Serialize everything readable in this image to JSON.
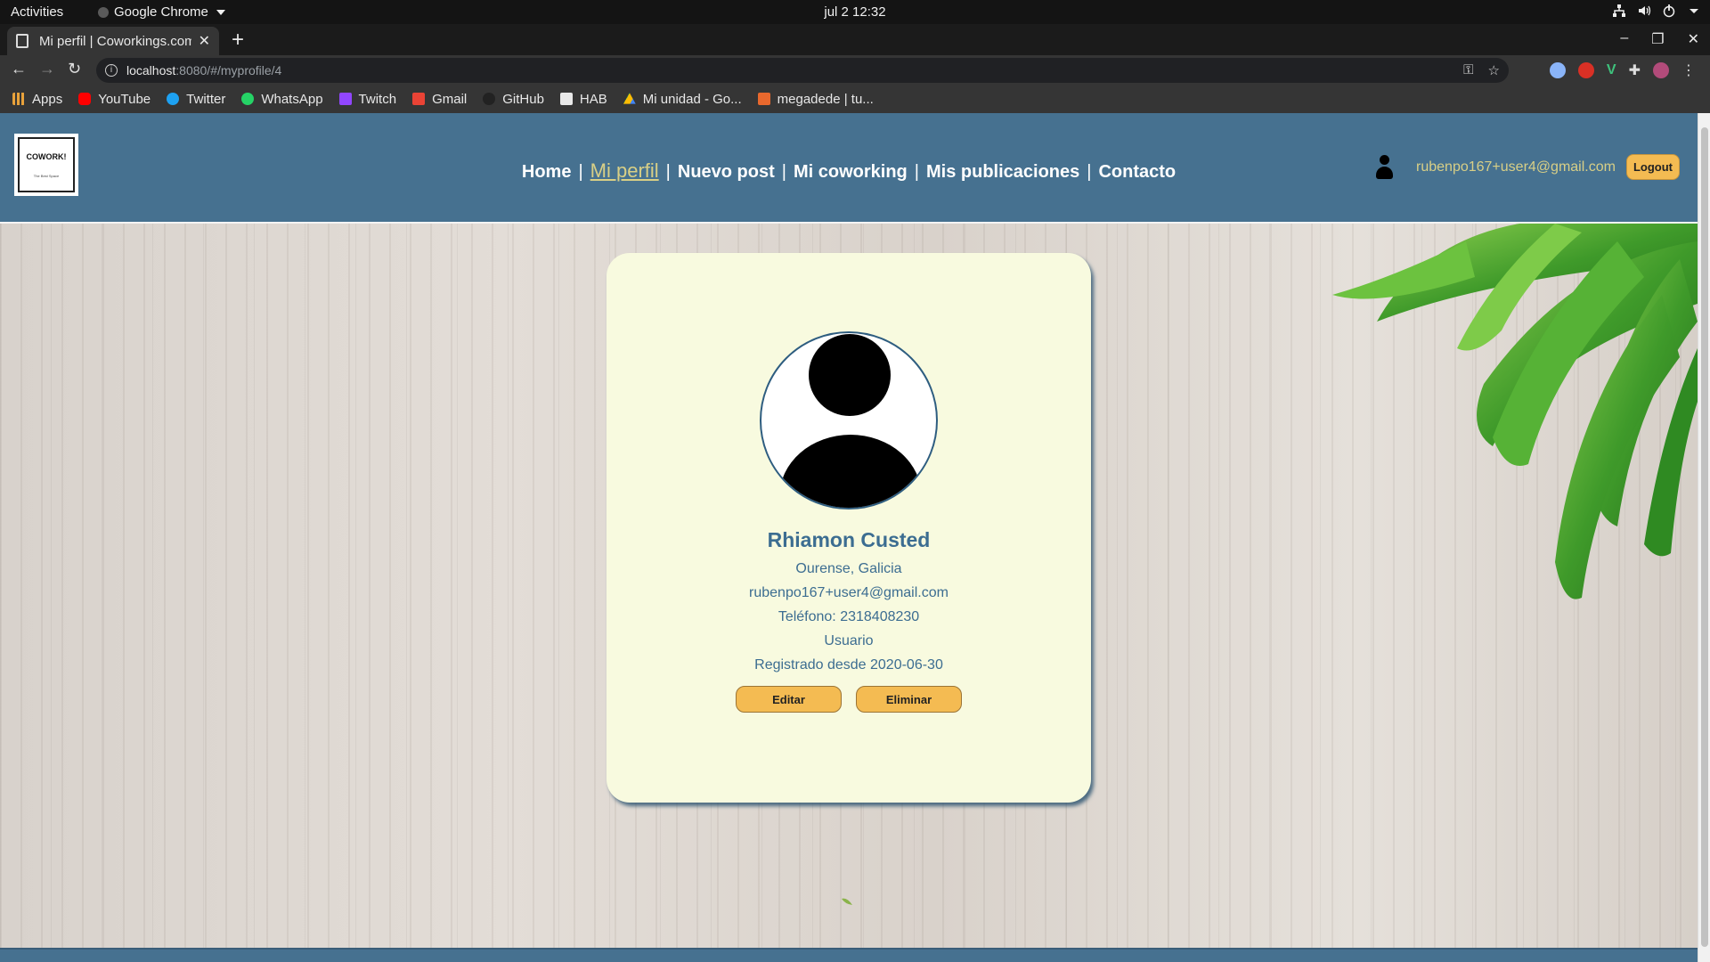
{
  "system": {
    "activities_label": "Activities",
    "app_name": "Google Chrome",
    "clock": "jul 2  12:32"
  },
  "browser": {
    "tab_title": "Mi perfil | Coworkings.com",
    "url_host": "localhost",
    "url_path": ":8080/#/myprofile/4",
    "bookmarks": [
      {
        "label": "Apps",
        "icon": "apps-grid-icon",
        "color": "#e9a23b"
      },
      {
        "label": "YouTube",
        "icon": "youtube-icon",
        "color": "#ff0000"
      },
      {
        "label": "Twitter",
        "icon": "twitter-icon",
        "color": "#1da1f2"
      },
      {
        "label": "WhatsApp",
        "icon": "whatsapp-icon",
        "color": "#25d366"
      },
      {
        "label": "Twitch",
        "icon": "twitch-icon",
        "color": "#9146ff"
      },
      {
        "label": "Gmail",
        "icon": "gmail-icon",
        "color": "#ea4335"
      },
      {
        "label": "GitHub",
        "icon": "github-icon",
        "color": "#000000"
      },
      {
        "label": "HAB",
        "icon": "folder-icon",
        "color": "#e8e8e8"
      },
      {
        "label": "Mi unidad - Go...",
        "icon": "google-drive-icon",
        "color": "#fbbc04"
      },
      {
        "label": "megadede | tu...",
        "icon": "megadede-icon",
        "color": "#e8682d"
      }
    ]
  },
  "site": {
    "logo_text": "COWORK!",
    "logo_subtext": "The Best Space",
    "nav": [
      {
        "label": "Home",
        "active": false
      },
      {
        "label": "Mi perfil",
        "active": true
      },
      {
        "label": "Nuevo post",
        "active": false
      },
      {
        "label": "Mi coworking",
        "active": false
      },
      {
        "label": "Mis publicaciones",
        "active": false
      },
      {
        "label": "Contacto",
        "active": false
      }
    ],
    "nav_separator": "|",
    "user_email": "rubenpo167+user4@gmail.com",
    "logout_label": "Logout"
  },
  "profile": {
    "name": "Rhiamon Custed",
    "location": "Ourense, Galicia",
    "email": "rubenpo167+user4@gmail.com",
    "phone": "Teléfono: 2318408230",
    "role": "Usuario",
    "registered": "Registrado desde 2020-06-30",
    "edit_label": "Editar",
    "delete_label": "Eliminar"
  },
  "colors": {
    "header_bg": "#467190",
    "accent_text": "#d8cf86",
    "button_bg": "#f4bb52",
    "card_bg": "#f8fadf",
    "profile_text": "#3c6d91"
  }
}
